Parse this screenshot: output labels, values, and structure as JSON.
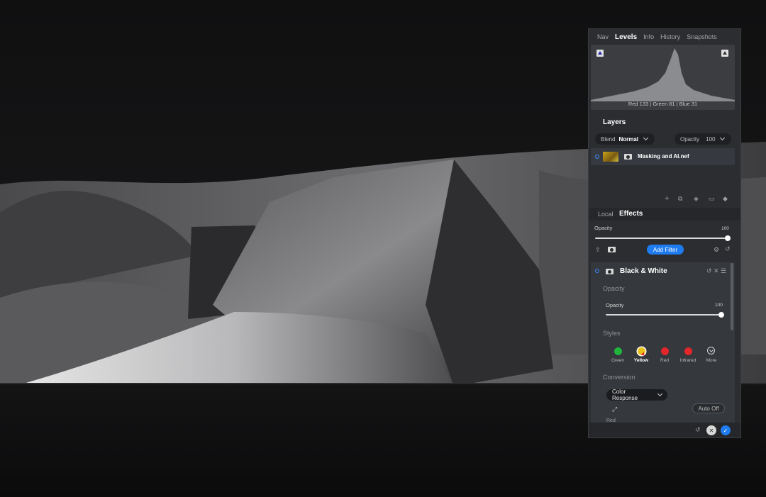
{
  "panel": {
    "top_tabs": [
      "Nav",
      "Levels",
      "Info",
      "History",
      "Snapshots"
    ],
    "active_top_tab": "Levels",
    "histogram": {
      "readout": "Red 133 | Green  81  | Blue  31"
    },
    "layers": {
      "title": "Layers",
      "blend_label": "Blend",
      "blend_value": "Normal",
      "opacity_label": "Opacity",
      "opacity_value": "100",
      "layer_name": "Masking and AI.nef"
    },
    "effects_tabs": [
      "Local",
      "Effects"
    ],
    "active_effects_tab": "Effects",
    "effects_opacity": {
      "label": "Opacity",
      "value": "100",
      "level": 1.0
    },
    "add_filter_label": "Add Filter",
    "bw_filter": {
      "title": "Black & White",
      "opacity_section": "Opacity",
      "opacity_label": "Opacity",
      "opacity_value": "100",
      "opacity_level": 1.0,
      "styles_section": "Styles",
      "styles": [
        {
          "label": "Green",
          "color": "#1fb53a"
        },
        {
          "label": "Yellow",
          "color": "#e8c21a",
          "selected": true
        },
        {
          "label": "Red",
          "color": "#e2262a"
        },
        {
          "label": "Infrared",
          "color": "#e2262a"
        },
        {
          "label": "More",
          "icon": "chevron-down-circle-icon"
        }
      ],
      "conversion_section": "Conversion",
      "conversion_mode": "Color Response",
      "auto_label": "Auto Off",
      "partial_label": "Red"
    },
    "colors": {
      "accent": "#1f7cf0",
      "panel_bg": "#2b2d30",
      "card_bg": "#35383d"
    }
  }
}
